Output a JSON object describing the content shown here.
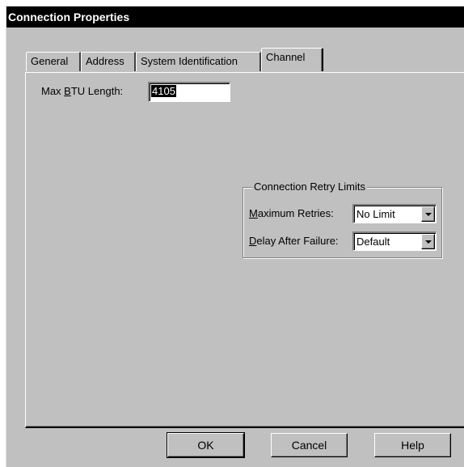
{
  "window": {
    "title": "Connection Properties"
  },
  "tabs": [
    {
      "label": "General",
      "active": false
    },
    {
      "label": "Address",
      "active": false
    },
    {
      "label": "System Identification",
      "active": false
    },
    {
      "label": "Channel",
      "active": true
    }
  ],
  "channel": {
    "max_btu_label_pre": "Max ",
    "max_btu_label_accel": "B",
    "max_btu_label_post": "TU Length:",
    "max_btu_value": "4105",
    "retry_group_title": "Connection Retry Limits",
    "max_retries_accel": "M",
    "max_retries_label_post": "aximum Retries:",
    "max_retries_value": "No Limit",
    "delay_accel": "D",
    "delay_label_post": "elay After Failure:",
    "delay_value": "Default"
  },
  "buttons": {
    "ok": "OK",
    "cancel": "Cancel",
    "help": "Help"
  },
  "icons": {
    "dropdown": "chevron-down-icon"
  }
}
